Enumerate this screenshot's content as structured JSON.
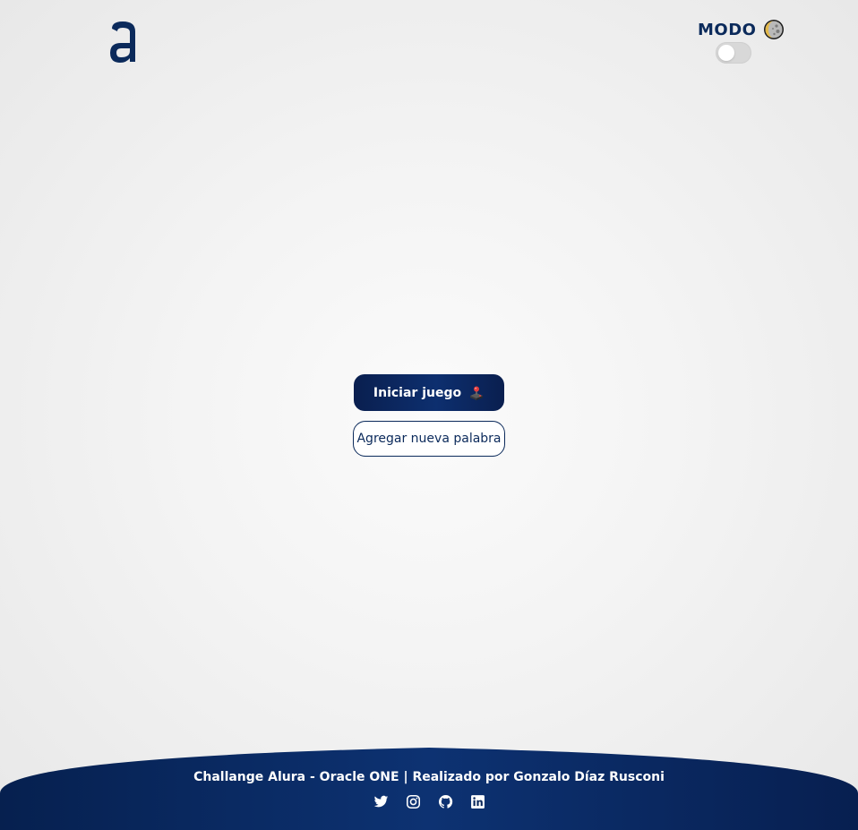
{
  "header": {
    "logo_icon": "alura-logo-icon",
    "mode_label": "MODO",
    "mode_icon": "moon-icon",
    "toggle_state": "off"
  },
  "main": {
    "start_button_label": "Iniciar juego",
    "start_button_icon": "joystick-icon",
    "add_word_button_label": "Agregar nueva palabra"
  },
  "footer": {
    "credit_text": "Challange Alura - Oracle ONE | Realizado por Gonzalo Díaz Rusconi",
    "social_links": [
      "twitter-icon",
      "instagram-icon",
      "github-icon",
      "linkedin-icon"
    ]
  },
  "colors": {
    "brand_navy": "#0b2a5b",
    "background": "#f3f3f3",
    "footer_gradient_start": "#06204f",
    "footer_gradient_end": "#0d3272"
  }
}
